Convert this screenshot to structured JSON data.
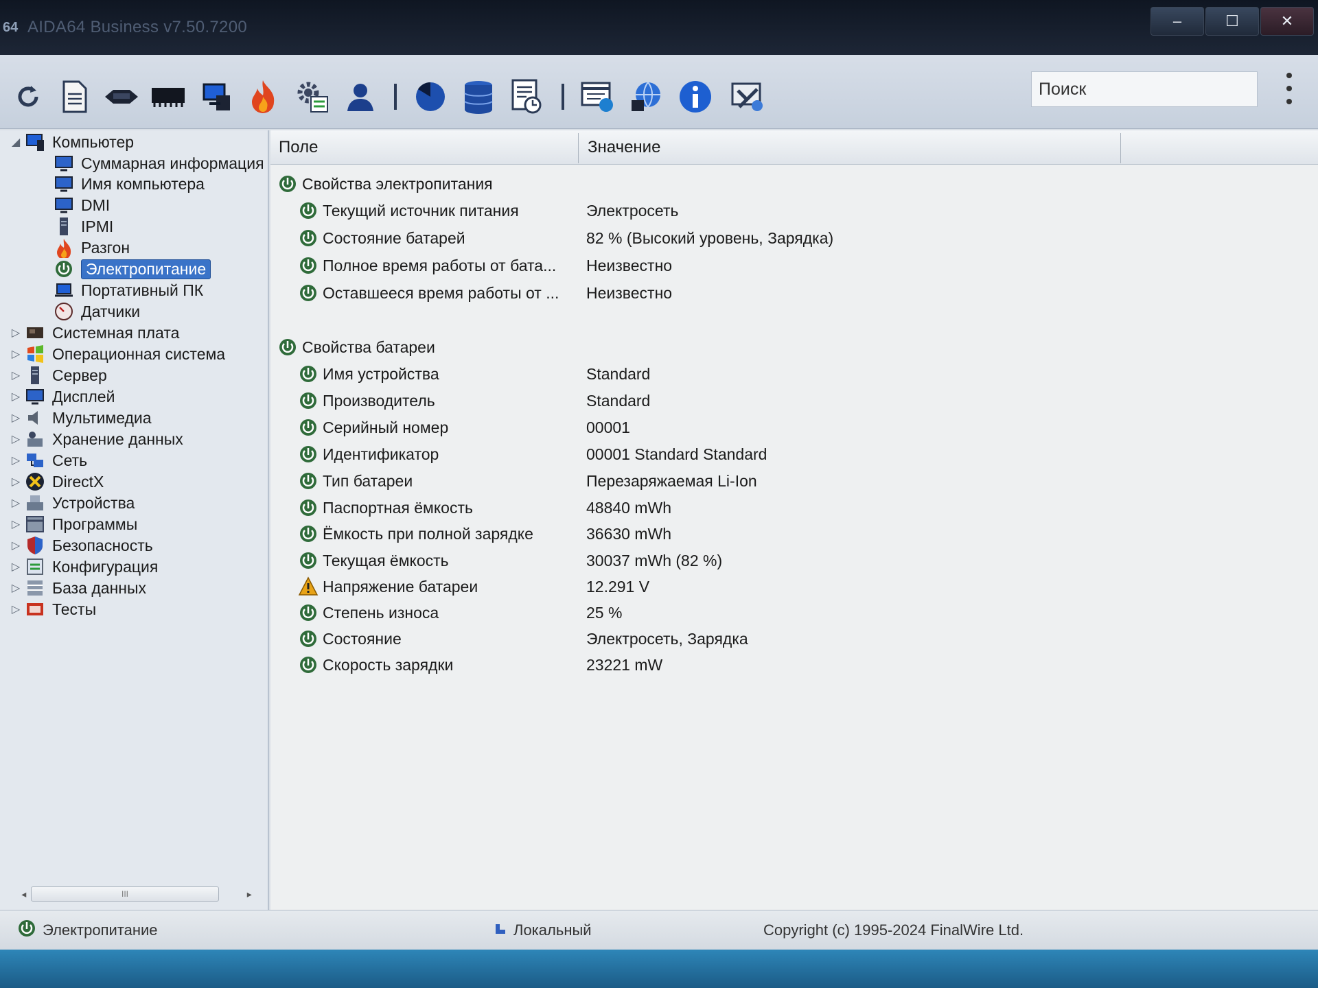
{
  "window": {
    "app_icon": "64",
    "title": "AIDA64 Business v7.50.7200",
    "controls": {
      "minimize": "‒",
      "maximize": "☐",
      "close": "✕"
    }
  },
  "toolbar": {
    "icons": [
      "refresh-icon",
      "report-icon",
      "motherboard-icon",
      "memory-icon",
      "computer-icon",
      "overclock-flame-icon",
      "settings-icon",
      "user-icon",
      "disk-pie-icon",
      "database-icon",
      "benchmark-icon",
      "bios-update-icon",
      "network-globe-icon",
      "info-icon",
      "tools-icon"
    ],
    "search_placeholder": "Поиск"
  },
  "tree": {
    "items": [
      {
        "label": "Компьютер",
        "icon": "computer-icon",
        "expander": "◢"
      },
      {
        "label": "Суммарная информация",
        "icon": "monitor-icon"
      },
      {
        "label": "Имя компьютера",
        "icon": "monitor-icon"
      },
      {
        "label": "DMI",
        "icon": "monitor-icon"
      },
      {
        "label": "IPMI",
        "icon": "server-icon"
      },
      {
        "label": "Разгон",
        "icon": "flame-icon"
      },
      {
        "label": "Электропитание",
        "icon": "power-icon",
        "selected": true
      },
      {
        "label": "Портативный ПК",
        "icon": "laptop-icon"
      },
      {
        "label": "Датчики",
        "icon": "gauge-icon"
      },
      {
        "label": "Системная плата",
        "icon": "motherboard-icon",
        "expander": "▷"
      },
      {
        "label": "Операционная система",
        "icon": "windows-icon",
        "expander": "▷"
      },
      {
        "label": "Сервер",
        "icon": "server-icon",
        "expander": "▷"
      },
      {
        "label": "Дисплей",
        "icon": "monitor-icon",
        "expander": "▷"
      },
      {
        "label": "Мультимедиа",
        "icon": "speaker-icon",
        "expander": "▷"
      },
      {
        "label": "Хранение данных",
        "icon": "storage-icon",
        "expander": "▷"
      },
      {
        "label": "Сеть",
        "icon": "network-icon",
        "expander": "▷"
      },
      {
        "label": "DirectX",
        "icon": "directx-icon",
        "expander": "▷"
      },
      {
        "label": "Устройства",
        "icon": "devices-icon",
        "expander": "▷"
      },
      {
        "label": "Программы",
        "icon": "programs-icon",
        "expander": "▷"
      },
      {
        "label": "Безопасность",
        "icon": "shield-icon",
        "expander": "▷"
      },
      {
        "label": "Конфигурация",
        "icon": "config-icon",
        "expander": "▷"
      },
      {
        "label": "База данных",
        "icon": "database-icon",
        "expander": "▷"
      },
      {
        "label": "Тесты",
        "icon": "benchmark-icon",
        "expander": "▷"
      }
    ],
    "scroll_thumb": "III"
  },
  "list": {
    "col_field": "Поле",
    "col_value": "Значение",
    "rows": [
      {
        "type": "group",
        "field": "Свойства электропитания",
        "value": "",
        "icon": "power-icon"
      },
      {
        "type": "item",
        "field": "Текущий источник питания",
        "value": "Электросеть",
        "icon": "power-icon"
      },
      {
        "type": "item",
        "field": "Состояние батарей",
        "value": "82 % (Высокий уровень, Зарядка)",
        "icon": "power-icon"
      },
      {
        "type": "item",
        "field": "Полное время работы от бата...",
        "value": "Неизвестно",
        "icon": "power-icon"
      },
      {
        "type": "item",
        "field": "Оставшееся время работы от ...",
        "value": "Неизвестно",
        "icon": "power-icon"
      },
      {
        "type": "group",
        "field": "Свойства батареи",
        "value": "",
        "icon": "power-icon"
      },
      {
        "type": "item",
        "field": "Имя устройства",
        "value": "Standard",
        "icon": "power-icon"
      },
      {
        "type": "item",
        "field": "Производитель",
        "value": "Standard",
        "icon": "power-icon"
      },
      {
        "type": "item",
        "field": "Серийный номер",
        "value": "00001",
        "icon": "power-icon"
      },
      {
        "type": "item",
        "field": "Идентификатор",
        "value": "00001 Standard Standard",
        "icon": "power-icon"
      },
      {
        "type": "item",
        "field": "Тип батареи",
        "value": "Перезаряжаемая Li-Ion",
        "icon": "power-icon"
      },
      {
        "type": "item",
        "field": "Паспортная ёмкость",
        "value": "48840 mWh",
        "icon": "power-icon"
      },
      {
        "type": "item",
        "field": "Ёмкость при полной зарядке",
        "value": "36630 mWh",
        "icon": "power-icon"
      },
      {
        "type": "item",
        "field": "Текущая ёмкость",
        "value": "30037 mWh  (82 %)",
        "icon": "power-icon"
      },
      {
        "type": "item",
        "field": "Напряжение батареи",
        "value": "12.291 V",
        "icon": "warning-icon"
      },
      {
        "type": "item",
        "field": "Степень износа",
        "value": "25 %",
        "icon": "power-icon"
      },
      {
        "type": "item",
        "field": "Состояние",
        "value": "Электросеть, Зарядка",
        "icon": "power-icon"
      },
      {
        "type": "item",
        "field": "Скорость зарядки",
        "value": "23221 mW",
        "icon": "power-icon"
      }
    ]
  },
  "status": {
    "section": "Электропитание",
    "mode": "Локальный",
    "copyright": "Copyright (c) 1995-2024 FinalWire Ltd."
  },
  "colors": {
    "selection": "#3a73c8",
    "power_green": "#2f6b3a",
    "warning": "#e8a317",
    "info_blue": "#1d5fd1"
  }
}
